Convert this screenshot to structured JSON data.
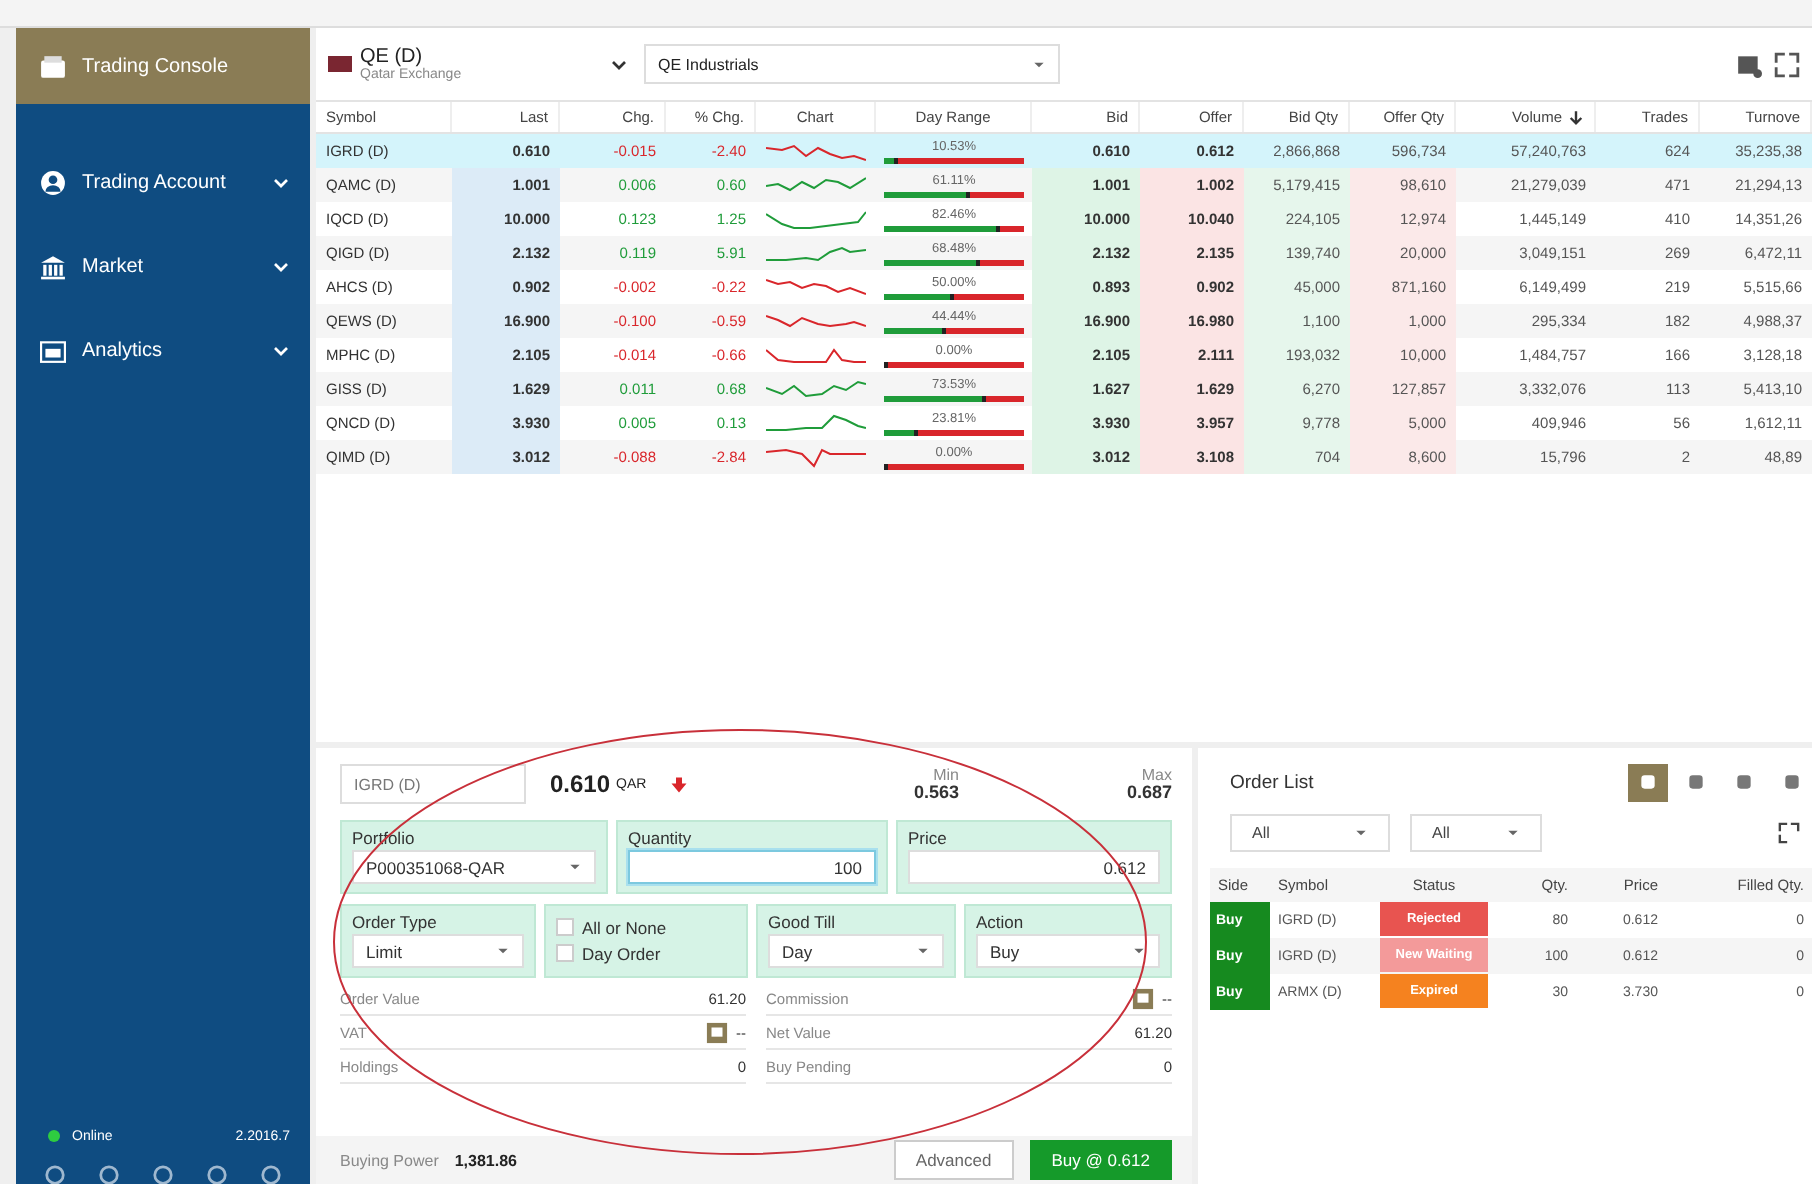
{
  "sidebar": {
    "items": [
      {
        "label": "Trading Console",
        "selected": true,
        "expandable": false
      },
      {
        "label": "Trading Account",
        "selected": false,
        "expandable": true
      },
      {
        "label": "Market",
        "selected": false,
        "expandable": true
      },
      {
        "label": "Analytics",
        "selected": false,
        "expandable": true
      }
    ],
    "status": {
      "label": "Online",
      "online": true,
      "version": "2.2016.7"
    }
  },
  "watchlist": {
    "exchange": {
      "code": "QE (D)",
      "name": "Qatar Exchange"
    },
    "sector": "QE Industrials",
    "columns": [
      {
        "label": "Symbol",
        "sorted": false
      },
      {
        "label": "Last",
        "sorted": false
      },
      {
        "label": "Chg.",
        "sorted": false
      },
      {
        "label": "% Chg.",
        "sorted": false
      },
      {
        "label": "Chart",
        "sorted": false
      },
      {
        "label": "Day Range",
        "sorted": false
      },
      {
        "label": "Bid",
        "sorted": false
      },
      {
        "label": "Offer",
        "sorted": false
      },
      {
        "label": "Bid Qty",
        "sorted": false
      },
      {
        "label": "Offer Qty",
        "sorted": false
      },
      {
        "label": "Volume",
        "sorted": true
      },
      {
        "label": "Trades",
        "sorted": false
      },
      {
        "label": "Turnove",
        "sorted": false
      }
    ],
    "rows": [
      {
        "symbol": "IGRD (D)",
        "last": "0.610",
        "chg": "-0.015",
        "pct_chg": "-2.40",
        "color": "#d9262b",
        "day_range": {
          "label": "10.53%",
          "level": 0.1053
        },
        "bid": "0.610",
        "offer": "0.612",
        "bid_qty": "2,866,868",
        "offer_qty": "596,734",
        "volume": "57,240,763",
        "trades": "624",
        "turnover": "35,235,38",
        "selected": true
      },
      {
        "symbol": "QAMC (D)",
        "last": "1.001",
        "chg": "0.006",
        "pct_chg": "0.60",
        "color": "#1f9c3a",
        "day_range": {
          "label": "61.11%",
          "level": 0.6111
        },
        "bid": "1.001",
        "offer": "1.002",
        "bid_qty": "5,179,415",
        "offer_qty": "98,610",
        "volume": "21,279,039",
        "trades": "471",
        "turnover": "21,294,13",
        "selected": false
      },
      {
        "symbol": "IQCD (D)",
        "last": "10.000",
        "chg": "0.123",
        "pct_chg": "1.25",
        "color": "#1f9c3a",
        "day_range": {
          "label": "82.46%",
          "level": 0.8246
        },
        "bid": "10.000",
        "offer": "10.040",
        "bid_qty": "224,105",
        "offer_qty": "12,974",
        "volume": "1,445,149",
        "trades": "410",
        "turnover": "14,351,26",
        "selected": false
      },
      {
        "symbol": "QIGD (D)",
        "last": "2.132",
        "chg": "0.119",
        "pct_chg": "5.91",
        "color": "#1f9c3a",
        "day_range": {
          "label": "68.48%",
          "level": 0.6848
        },
        "bid": "2.132",
        "offer": "2.135",
        "bid_qty": "139,740",
        "offer_qty": "20,000",
        "volume": "3,049,151",
        "trades": "269",
        "turnover": "6,472,11",
        "selected": false
      },
      {
        "symbol": "AHCS (D)",
        "last": "0.902",
        "chg": "-0.002",
        "pct_chg": "-0.22",
        "color": "#d9262b",
        "day_range": {
          "label": "50.00%",
          "level": 0.5
        },
        "bid": "0.893",
        "offer": "0.902",
        "bid_qty": "45,000",
        "offer_qty": "871,160",
        "volume": "6,149,499",
        "trades": "219",
        "turnover": "5,515,66",
        "selected": false
      },
      {
        "symbol": "QEWS (D)",
        "last": "16.900",
        "chg": "-0.100",
        "pct_chg": "-0.59",
        "color": "#d9262b",
        "day_range": {
          "label": "44.44%",
          "level": 0.4444
        },
        "bid": "16.900",
        "offer": "16.980",
        "bid_qty": "1,100",
        "offer_qty": "1,000",
        "volume": "295,334",
        "trades": "182",
        "turnover": "4,988,37",
        "selected": false
      },
      {
        "symbol": "MPHC (D)",
        "last": "2.105",
        "chg": "-0.014",
        "pct_chg": "-0.66",
        "color": "#d9262b",
        "day_range": {
          "label": "0.00%",
          "level": 0
        },
        "bid": "2.105",
        "offer": "2.111",
        "bid_qty": "193,032",
        "offer_qty": "10,000",
        "volume": "1,484,757",
        "trades": "166",
        "turnover": "3,128,18",
        "selected": false
      },
      {
        "symbol": "GISS (D)",
        "last": "1.629",
        "chg": "0.011",
        "pct_chg": "0.68",
        "color": "#1f9c3a",
        "day_range": {
          "label": "73.53%",
          "level": 0.7353
        },
        "bid": "1.627",
        "offer": "1.629",
        "bid_qty": "6,270",
        "offer_qty": "127,857",
        "volume": "3,332,076",
        "trades": "113",
        "turnover": "5,413,10",
        "selected": false
      },
      {
        "symbol": "QNCD (D)",
        "last": "3.930",
        "chg": "0.005",
        "pct_chg": "0.13",
        "color": "#1f9c3a",
        "day_range": {
          "label": "23.81%",
          "level": 0.2381
        },
        "bid": "3.930",
        "offer": "3.957",
        "bid_qty": "9,778",
        "offer_qty": "5,000",
        "volume": "409,946",
        "trades": "56",
        "turnover": "1,612,11",
        "selected": false
      },
      {
        "symbol": "QIMD (D)",
        "last": "3.012",
        "chg": "-0.088",
        "pct_chg": "-2.84",
        "color": "#d9262b",
        "day_range": {
          "label": "0.00%",
          "level": 0
        },
        "bid": "3.012",
        "offer": "3.108",
        "bid_qty": "704",
        "offer_qty": "8,600",
        "volume": "15,796",
        "trades": "2",
        "turnover": "48,89",
        "selected": false
      }
    ]
  },
  "order_ticket": {
    "symbol": "IGRD (D)",
    "price": "0.610",
    "currency": "QAR",
    "falling": true,
    "min": {
      "label": "Min",
      "value": "0.563"
    },
    "max": {
      "label": "Max",
      "value": "0.687"
    },
    "portfolio": {
      "label": "Portfolio",
      "value": "P000351068-QAR"
    },
    "quantity": {
      "label": "Quantity",
      "value": "100",
      "focused": true
    },
    "price_field": {
      "label": "Price",
      "value": "0.612"
    },
    "order_type": {
      "label": "Order Type",
      "value": "Limit"
    },
    "options": [
      {
        "label": "All or None",
        "checked": false
      },
      {
        "label": "Day Order",
        "checked": false
      }
    ],
    "good_till": {
      "label": "Good Till",
      "value": "Day"
    },
    "action": {
      "label": "Action",
      "value": "Buy"
    },
    "summary_left": [
      {
        "label": "Order Value",
        "value": "61.20",
        "has_icon": false
      },
      {
        "label": "VAT",
        "value": "--",
        "has_icon": true
      },
      {
        "label": "Holdings",
        "value": "0",
        "has_icon": false
      }
    ],
    "summary_right": [
      {
        "label": "Commission",
        "value": "--",
        "has_icon": true
      },
      {
        "label": "Net Value",
        "value": "61.20",
        "has_icon": false
      },
      {
        "label": "Buy Pending",
        "value": "0",
        "has_icon": false
      }
    ],
    "buying_power": {
      "label": "Buying Power",
      "value": "1,381.86"
    },
    "buttons": [
      {
        "label": "Advanced",
        "kind": "secondary"
      },
      {
        "label": "Buy @ 0.612",
        "kind": "primary"
      }
    ]
  },
  "order_list": {
    "title": "Order List",
    "tools": [
      {
        "selected": true
      },
      {
        "selected": false
      },
      {
        "selected": false
      },
      {
        "selected": false
      }
    ],
    "filters": [
      "All",
      "All"
    ],
    "columns": [
      "Side",
      "Symbol",
      "Status",
      "Qty.",
      "Price",
      "Filled Qty."
    ],
    "rows": [
      {
        "side": "Buy",
        "symbol": "IGRD (D)",
        "status": "Rejected",
        "color": "#e85450",
        "qty": "80",
        "price": "0.612",
        "filled": "0"
      },
      {
        "side": "Buy",
        "symbol": "IGRD (D)",
        "status": "New Waiting",
        "color": "#f39a9a",
        "qty": "100",
        "price": "0.612",
        "filled": "0"
      },
      {
        "side": "Buy",
        "symbol": "ARMX (D)",
        "status": "Expired",
        "color": "#f5821f",
        "qty": "30",
        "price": "3.730",
        "filled": "0"
      }
    ]
  }
}
